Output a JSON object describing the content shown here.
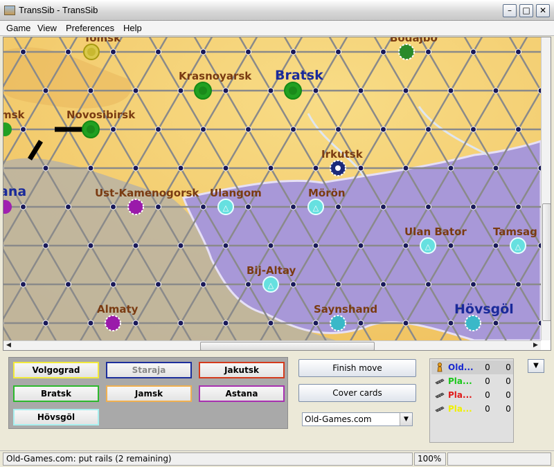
{
  "window": {
    "title": "TransSib - TransSib"
  },
  "menu": [
    "Game",
    "View",
    "Preferences",
    "Help"
  ],
  "map": {
    "cities": [
      {
        "name": "Tomsk",
        "color": "#7a3b12"
      },
      {
        "name": "Bodajbo",
        "color": "#7a3b12"
      },
      {
        "name": "Krasnoyarsk",
        "color": "#7a3b12"
      },
      {
        "name": "Bratsk",
        "color": "#1a2a9a"
      },
      {
        "name": "msk",
        "color": "#7a3b12"
      },
      {
        "name": "Novosibirsk",
        "color": "#7a3b12"
      },
      {
        "name": "Irkutsk",
        "color": "#7a3b12"
      },
      {
        "name": "ana",
        "color": "#1a2a9a"
      },
      {
        "name": "Ust-Kamenogorsk",
        "color": "#7a3b12"
      },
      {
        "name": "Ulangom",
        "color": "#7a3b12"
      },
      {
        "name": "Mörön",
        "color": "#7a3b12"
      },
      {
        "name": "Ulan Bator",
        "color": "#7a3b12"
      },
      {
        "name": "Tamsag",
        "color": "#7a3b12"
      },
      {
        "name": "Bij-Altay",
        "color": "#7a3b12"
      },
      {
        "name": "Almaty",
        "color": "#7a3b12"
      },
      {
        "name": "Saynshand",
        "color": "#7a3b12"
      },
      {
        "name": "Hövsgöl",
        "color": "#1a2a9a"
      }
    ]
  },
  "cards": [
    {
      "label": "Volgograd",
      "border": "#f2ea3a",
      "text": "#000000"
    },
    {
      "label": "Staraja",
      "border": "#1c2e9c",
      "text": "#888888"
    },
    {
      "label": "Jakutsk",
      "border": "#d43a1c",
      "text": "#000000"
    },
    {
      "label": "Bratsk",
      "border": "#2cb82c",
      "text": "#000000"
    },
    {
      "label": "Jamsk",
      "border": "#f0b050",
      "text": "#000000"
    },
    {
      "label": "Astana",
      "border": "#a830b0",
      "text": "#000000"
    },
    {
      "label": "Hövsgöl",
      "border": "#a8f0f0",
      "text": "#000000"
    }
  ],
  "buttons": {
    "finish_move": "Finish move",
    "cover_cards": "Cover cards"
  },
  "player_select": {
    "value": "Old-Games.com"
  },
  "players": [
    {
      "name": "Old...",
      "color": "#1a2ad0",
      "a": "0",
      "b": "0",
      "icon": "pawn-icon"
    },
    {
      "name": "Pla...",
      "color": "#1ac81a",
      "a": "0",
      "b": "0",
      "icon": "rail-icon"
    },
    {
      "name": "Pla...",
      "color": "#e01a1a",
      "a": "0",
      "b": "0",
      "icon": "rail-icon"
    },
    {
      "name": "Pla...",
      "color": "#f0f000",
      "a": "0",
      "b": "0",
      "icon": "rail-icon"
    }
  ],
  "status": {
    "message": "Old-Games.com: put rails (2 remaining)",
    "zoom": "100%"
  }
}
